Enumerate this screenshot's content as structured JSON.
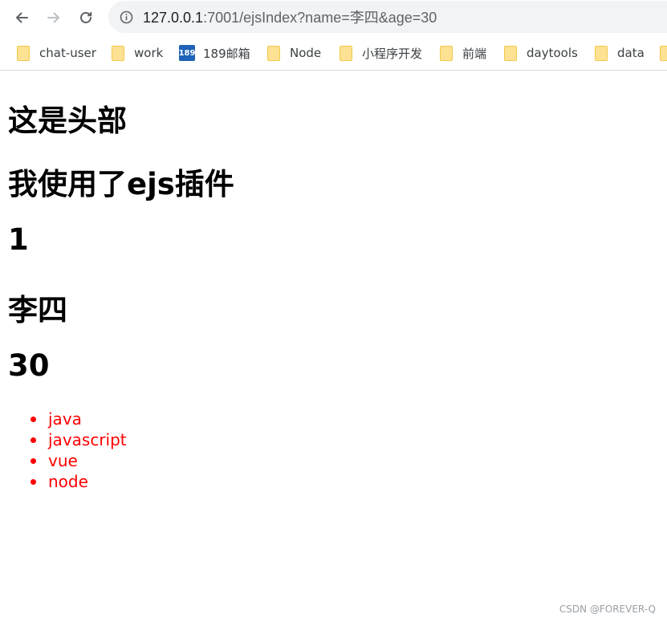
{
  "browser": {
    "url_host": "127.0.0.1",
    "url_rest": ":7001/ejsIndex?name=李四&age=30",
    "back_icon": "arrow-left-icon",
    "forward_icon": "arrow-right-icon",
    "reload_icon": "reload-icon",
    "info_icon": "info-icon"
  },
  "bookmarks": [
    {
      "label": "chat-user",
      "icon": "folder-icon"
    },
    {
      "label": "work",
      "icon": "folder-icon"
    },
    {
      "label": "189邮箱",
      "icon": "189-mail-icon",
      "badge": "189"
    },
    {
      "label": "Node",
      "icon": "folder-icon"
    },
    {
      "label": "小程序开发",
      "icon": "folder-icon"
    },
    {
      "label": "前端",
      "icon": "folder-icon"
    },
    {
      "label": "daytools",
      "icon": "folder-icon"
    },
    {
      "label": "data",
      "icon": "folder-icon"
    }
  ],
  "page": {
    "header": "这是头部",
    "title": "我使用了ejs插件",
    "number": "1",
    "name": "李四",
    "age": "30",
    "list_color": "#ff0000",
    "list": [
      "java",
      "javascript",
      "vue",
      "node"
    ]
  },
  "watermark": "CSDN @FOREVER-Q"
}
